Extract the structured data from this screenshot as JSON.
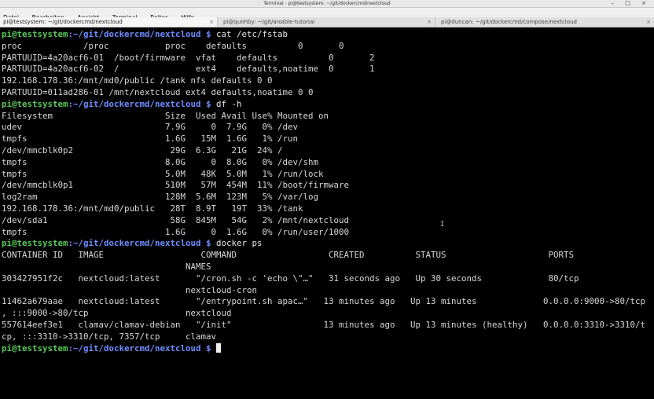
{
  "window": {
    "title": "Terminal - pi@testsystem: ~/git/dockercmd/nextcloud",
    "controls": "– □ ×"
  },
  "menu": [
    "Datei",
    "Bearbeiten",
    "Ansicht",
    "Terminal",
    "Reiter",
    "Hilfe"
  ],
  "tabs": [
    {
      "label": "pi@testsystem: ~/git/dockercmd/nextcloud",
      "close": "×"
    },
    {
      "label": "pi@quimby: ~/git/ansible-tutorial",
      "close": "×"
    },
    {
      "label": "pi@duncan: ~/git/dockercmd/compose/nextcloud",
      "close": "×"
    }
  ],
  "prompt": {
    "user_host": "pi@testsystem",
    "path": ":~/git/dockercmd/nextcloud $"
  },
  "lines": [
    {
      "prompt": true,
      "cmd": " cat /etc/fstab"
    },
    {
      "text": "proc            /proc           proc    defaults          0       0"
    },
    {
      "text": "PARTUUID=4a20acf6-01  /boot/firmware  vfat    defaults          0       2"
    },
    {
      "text": "PARTUUID=4a20acf6-02  /               ext4    defaults,noatime  0       1"
    },
    {
      "text": "192.168.178.36:/mnt/md0/public /tank nfs defaults 0 0"
    },
    {
      "text": "PARTUUID=011ad286-01 /mnt/nextcloud ext4 defaults,noatime 0 0"
    },
    {
      "prompt": true,
      "cmd": " df -h"
    },
    {
      "text": "Filesystem                      Size  Used Avail Use% Mounted on"
    },
    {
      "text": "udev                            7.9G     0  7.9G   0% /dev"
    },
    {
      "text": "tmpfs                           1.6G   15M  1.6G   1% /run"
    },
    {
      "text": "/dev/mmcblk0p2                   29G  6.3G   21G  24% /"
    },
    {
      "text": "tmpfs                           8.0G     0  8.0G   0% /dev/shm"
    },
    {
      "text": "tmpfs                           5.0M   48K  5.0M   1% /run/lock"
    },
    {
      "text": "/dev/mmcblk0p1                  510M   57M  454M  11% /boot/firmware"
    },
    {
      "text": "log2ram                         128M  5.6M  123M   5% /var/log"
    },
    {
      "text": "192.168.178.36:/mnt/md0/public   28T  8.9T   19T  33% /tank"
    },
    {
      "text": "/dev/sda1                        58G  845M   54G   2% /mnt/nextcloud"
    },
    {
      "text": "tmpfs                           1.6G     0  1.6G   0% /run/user/1000"
    },
    {
      "prompt": true,
      "cmd": " docker ps"
    },
    {
      "text": "CONTAINER ID   IMAGE                   COMMAND                  CREATED          STATUS                    PORTS"
    },
    {
      "text": "                                    NAMES"
    },
    {
      "text": "303427951f2c   nextcloud:latest       \"/cron.sh -c 'echo \\\"…\"   31 seconds ago   Up 30 seconds             80/tcp"
    },
    {
      "text": "                                    nextcloud-cron"
    },
    {
      "text": "11462a679aae   nextcloud:latest       \"/entrypoint.sh apac…\"   13 minutes ago   Up 13 minutes             0.0.0.0:9000->80/tcp"
    },
    {
      "text": ", :::9000->80/tcp                   nextcloud"
    },
    {
      "text": "557614eef3e1   clamav/clamav-debian   \"/init\"                  13 minutes ago   Up 13 minutes (healthy)   0.0.0.0:3310->3310/t"
    },
    {
      "text": "cp, :::3310->3310/tcp, 7357/tcp     clamav"
    },
    {
      "prompt": true,
      "cmd": " ",
      "cursor": true
    }
  ]
}
